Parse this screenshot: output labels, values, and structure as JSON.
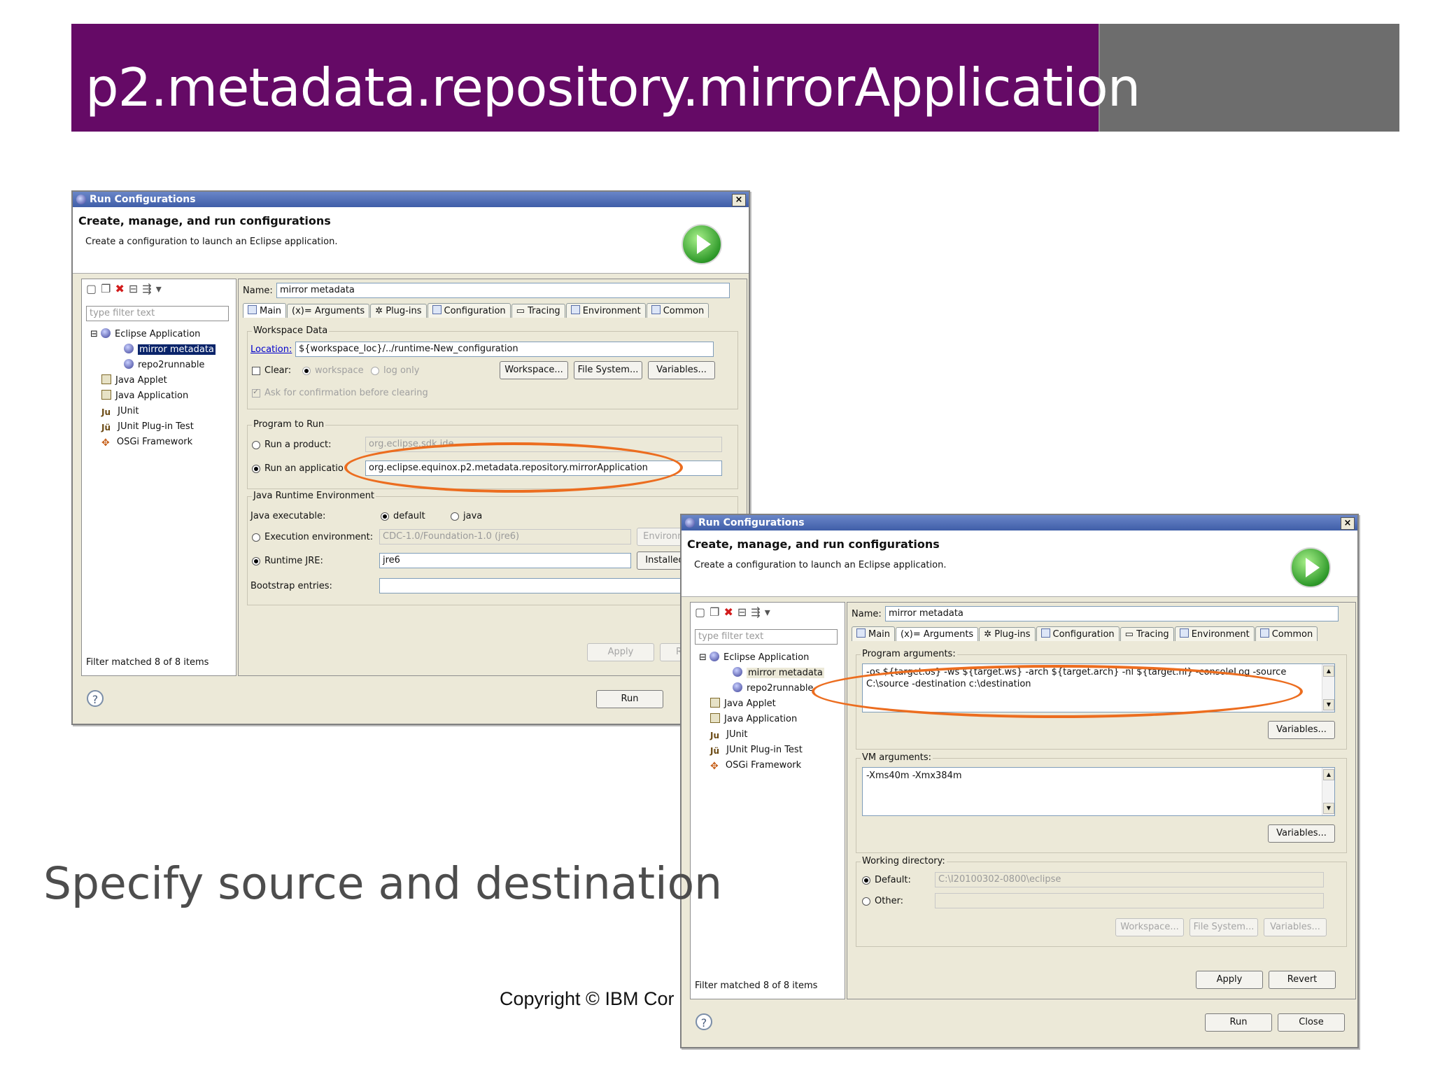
{
  "slide": {
    "title": "p2.metadata.repository.mirrorApplication",
    "subtitle": "Specify source and destination",
    "copyright": "Copyright © IBM Cor"
  },
  "dialog_common": {
    "window_title": "Run Configurations",
    "header_title": "Create, manage, and run configurations",
    "header_desc": "Create a configuration to launch an Eclipse application.",
    "filter_placeholder": "type filter text",
    "filter_status": "Filter matched 8 of 8 items",
    "name_label": "Name:",
    "name_value": "mirror metadata",
    "tree": [
      "Eclipse Application",
      "mirror metadata",
      "repo2runnable",
      "Java Applet",
      "Java Application",
      "JUnit",
      "JUnit Plug-in Test",
      "OSGi Framework"
    ],
    "tabs": [
      "Main",
      "Arguments",
      "Plug-ins",
      "Configuration",
      "Tracing",
      "Environment",
      "Common"
    ],
    "run": "Run",
    "help": "?"
  },
  "dialog1": {
    "workspace_group": "Workspace Data",
    "location_label": "Location:",
    "location_value": "${workspace_loc}/../runtime-New_configuration",
    "clear_label": "Clear:",
    "workspace_radio": "workspace",
    "log_only_radio": "log only",
    "workspace_btn": "Workspace...",
    "filesystem_btn": "File System...",
    "variables_btn": "Variables...",
    "ask_confirm": "Ask for confirmation before clearing",
    "program_group": "Program to Run",
    "run_product": "Run a product:",
    "product_value": "org.eclipse.sdk.ide",
    "run_application": "Run an applicatio",
    "application_value": "org.eclipse.equinox.p2.metadata.repository.mirrorApplication",
    "jre_group": "Java Runtime Environment",
    "java_exec": "Java executable:",
    "default_radio": "default",
    "java_radio": "java",
    "exec_env": "Execution environment:",
    "exec_env_value": "CDC-1.0/Foundation-1.0 (jre6)",
    "environm_btn": "Environm",
    "runtime_jre": "Runtime JRE:",
    "jre_value": "jre6",
    "installed_btn": "Installed",
    "bootstrap": "Bootstrap entries:",
    "apply": "Apply",
    "revert_partial": "R"
  },
  "dialog2": {
    "program_args_label": "Program arguments:",
    "program_args_line1": "-os ${target.os} -ws ${target.ws} -arch ${target.arch} -nl ${target.nl} -consoleLog  -source",
    "program_args_line2": "C:\\source -destination c:\\destination",
    "variables_btn": "Variables...",
    "vm_args_label": "VM arguments:",
    "vm_args_value": "-Xms40m -Xmx384m",
    "variables_btn2": "Variables...",
    "working_dir_label": "Working directory:",
    "default_label": "Default:",
    "default_value": "C:\\I20100302-0800\\eclipse",
    "other_label": "Other:",
    "workspace_btn": "Workspace...",
    "filesystem_btn": "File System...",
    "variables_btn3": "Variables...",
    "apply": "Apply",
    "revert": "Revert",
    "close": "Close"
  },
  "colors": {
    "banner": "#650a66",
    "banner_gray": "#6d6d6d",
    "highlight": "#ec6d1f"
  }
}
